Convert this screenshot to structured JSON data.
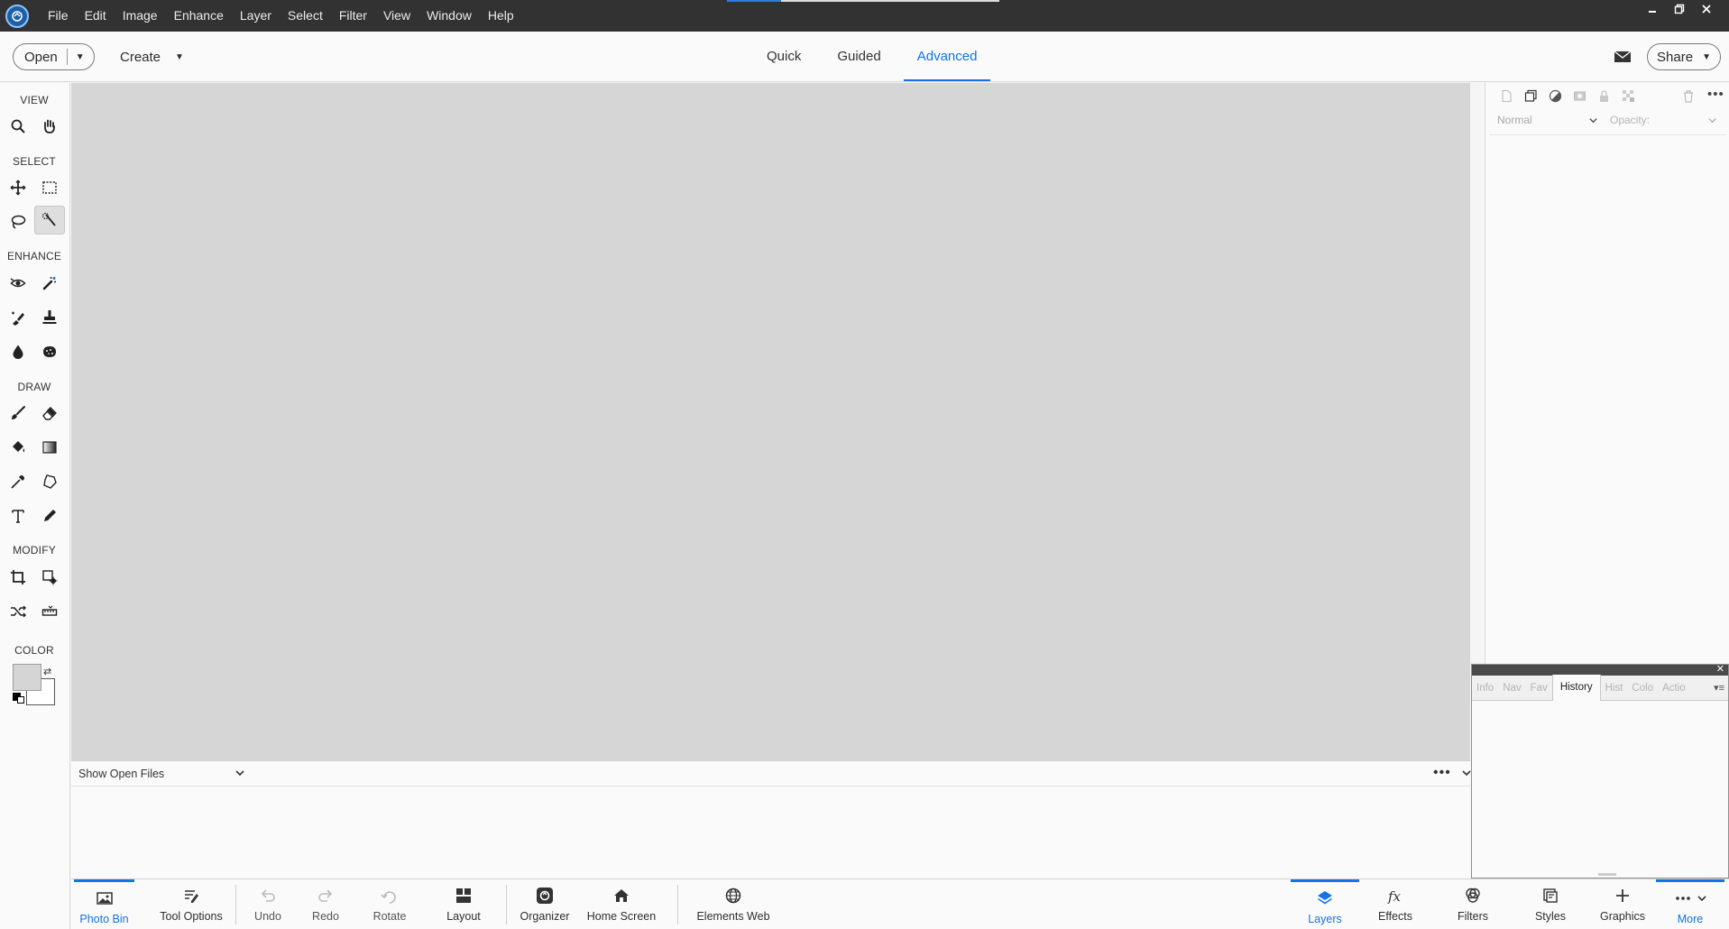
{
  "menubar": {
    "items": [
      "File",
      "Edit",
      "Image",
      "Enhance",
      "Layer",
      "Select",
      "Filter",
      "View",
      "Window",
      "Help"
    ],
    "window_controls": [
      "minimize",
      "restore",
      "close"
    ]
  },
  "topbar": {
    "open_label": "Open",
    "create_label": "Create",
    "modes": [
      "Quick",
      "Guided",
      "Advanced"
    ],
    "active_mode": "Advanced",
    "share_label": "Share"
  },
  "toolpanel": {
    "sections": {
      "view": "VIEW",
      "select": "SELECT",
      "enhance": "ENHANCE",
      "draw": "DRAW",
      "modify": "MODIFY",
      "color": "COLOR"
    },
    "tools": [
      "zoom-tool",
      "hand-tool",
      "move-tool",
      "marquee-tool",
      "lasso-tool",
      "quick-selection-tool",
      "red-eye-tool",
      "spot-healing-tool",
      "smart-brush-tool",
      "clone-stamp-tool",
      "blur-tool",
      "sponge-tool",
      "brush-tool",
      "eraser-tool",
      "paint-bucket-tool",
      "gradient-tool",
      "eyedropper-tool",
      "custom-shape-tool",
      "type-tool",
      "pencil-tool",
      "crop-tool",
      "recompose-tool",
      "content-aware-move-tool",
      "straighten-tool"
    ],
    "active_tool": "quick-selection-tool",
    "foreground_color": "#d5d5d5",
    "background_color": "#ffffff"
  },
  "photobin": {
    "dropdown_label": "Show Open Files"
  },
  "layers_panel": {
    "blend_mode": "Normal",
    "opacity_label": "Opacity:"
  },
  "history_panel": {
    "tabs": [
      "Info",
      "Nav",
      "Fav",
      "History",
      "Hist",
      "Colo",
      "Actio"
    ],
    "active_tab": "History"
  },
  "taskbar": {
    "photo_bin": "Photo Bin",
    "tool_options": "Tool Options",
    "undo": "Undo",
    "redo": "Redo",
    "rotate": "Rotate",
    "layout": "Layout",
    "organizer": "Organizer",
    "home_screen": "Home Screen",
    "elements_web": "Elements Web",
    "layers": "Layers",
    "effects": "Effects",
    "filters": "Filters",
    "styles": "Styles",
    "graphics": "Graphics",
    "more": "More"
  },
  "colors": {
    "accent": "#1473e6",
    "menubar_bg": "#323232",
    "canvas_bg": "#d6d6d6"
  }
}
